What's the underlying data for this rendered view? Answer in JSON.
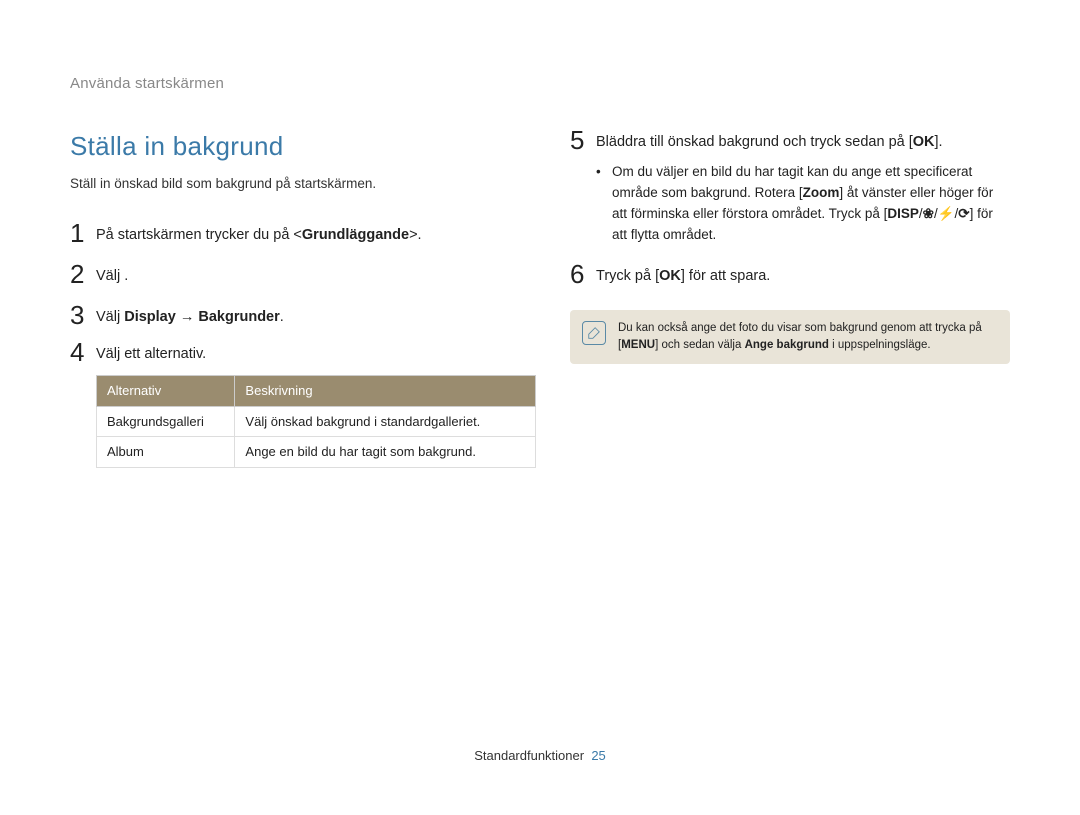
{
  "breadcrumb": "Använda startskärmen",
  "heading": "Ställa in bakgrund",
  "subtitle": "Ställ in önskad bild som bakgrund på startskärmen.",
  "leftCol": {
    "step1": {
      "num": "1",
      "pre": "På startskärmen trycker du på <",
      "bold": "Grundläggande",
      "post": ">."
    },
    "step2": {
      "num": "2",
      "pre": "Välj ",
      "post": "."
    },
    "step3": {
      "num": "3",
      "pre": "Välj ",
      "b1": "Display",
      "mid": " → ",
      "b2": "Bakgrunder",
      "post": "."
    },
    "step4": {
      "num": "4",
      "text": "Välj ett alternativ."
    },
    "table": {
      "th1": "Alternativ",
      "th2": "Beskrivning",
      "rows": [
        {
          "c1": "Bakgrundsgalleri",
          "c2": "Välj önskad bakgrund i standardgalleriet."
        },
        {
          "c1": "Album",
          "c2": "Ange en bild du har tagit som bakgrund."
        }
      ]
    }
  },
  "rightCol": {
    "step5": {
      "num": "5",
      "pre": "Bläddra till önskad bakgrund och tryck sedan på [",
      "ok": "OK",
      "post": "]."
    },
    "bullet": {
      "l1a": "Om du väljer en bild du har tagit kan du ange ett specificerat område som bakgrund. Rotera [",
      "zoom": "Zoom",
      "l1b": "] åt vänster eller höger för att förminska eller förstora området. Tryck på [",
      "disp": "DISP",
      "sep": "/",
      "macro": "❀",
      "flash": "⚡",
      "timer": "⟳",
      "l1c": "] för att flytta området."
    },
    "step6": {
      "num": "6",
      "pre": "Tryck på [",
      "ok": "OK",
      "post": "] för att spara."
    },
    "note": {
      "l1": "Du kan också ange det foto du visar som bakgrund genom att trycka på [",
      "menu": "MENU",
      "l2": "] och sedan välja ",
      "b": "Ange bakgrund",
      "l3": " i uppspelningsläge."
    }
  },
  "footer": {
    "label": "Standardfunktioner",
    "page": "25"
  }
}
